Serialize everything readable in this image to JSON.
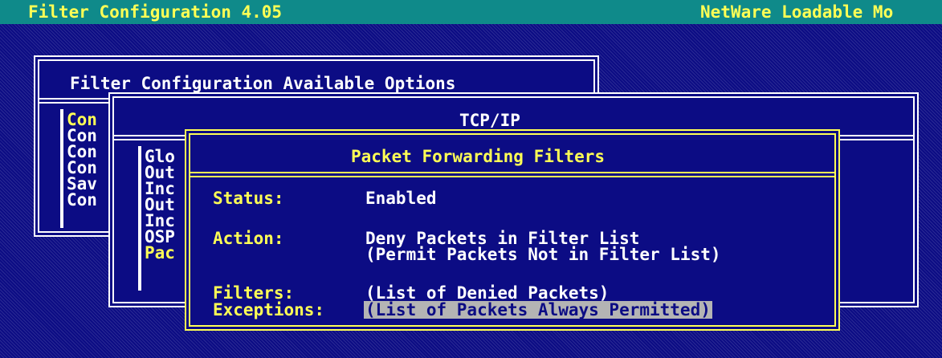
{
  "titlebar": {
    "left": "Filter Configuration  4.05",
    "right": "NetWare Loadable Mo"
  },
  "main_menu": {
    "title": "Filter Configuration Available Options",
    "items": [
      "Con",
      "Con",
      "Con",
      "Con",
      "Sav",
      "Con"
    ]
  },
  "tcpip": {
    "title": "TCP/IP",
    "items": [
      "Glo",
      "Out",
      "Inc",
      "Out",
      "Inc",
      "OSP",
      "Pac"
    ]
  },
  "pff": {
    "title": "Packet Forwarding Filters",
    "status_label": "Status:",
    "status_value": "Enabled",
    "action_label": "Action:",
    "action_value_1": "Deny Packets in Filter List",
    "action_value_2": "(Permit Packets Not in Filter List)",
    "filters_label": "Filters:",
    "filters_value": "(List of Denied Packets)",
    "exceptions_label": "Exceptions:",
    "exceptions_value": "(List of Packets Always Permitted)"
  },
  "colors": {
    "background": "#0c0c84",
    "titlebar": "#0f8a8a",
    "highlight_text": "#ffff55",
    "selection": "#b4b4b4"
  }
}
